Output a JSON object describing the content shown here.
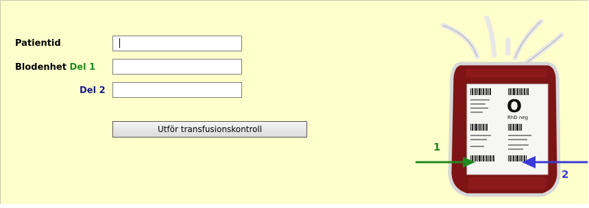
{
  "form": {
    "patient_label": "Patientid",
    "patient_value": "",
    "unit_label": "Blodenhet",
    "part1_label": "Del 1",
    "part1_value": "",
    "part2_label": "Del 2",
    "part2_value": "",
    "submit_label": "Utför transfusionskontroll"
  },
  "illustration": {
    "blood_type": "O",
    "rh": "RhD neg",
    "callout_1": "1",
    "callout_2": "2"
  },
  "colors": {
    "background": "#ffffcc",
    "part1_color": "#1f8a1f",
    "part2_color": "#1a1a8c",
    "arrow_1": "#1f8a1f",
    "arrow_2": "#3a3ad8"
  }
}
